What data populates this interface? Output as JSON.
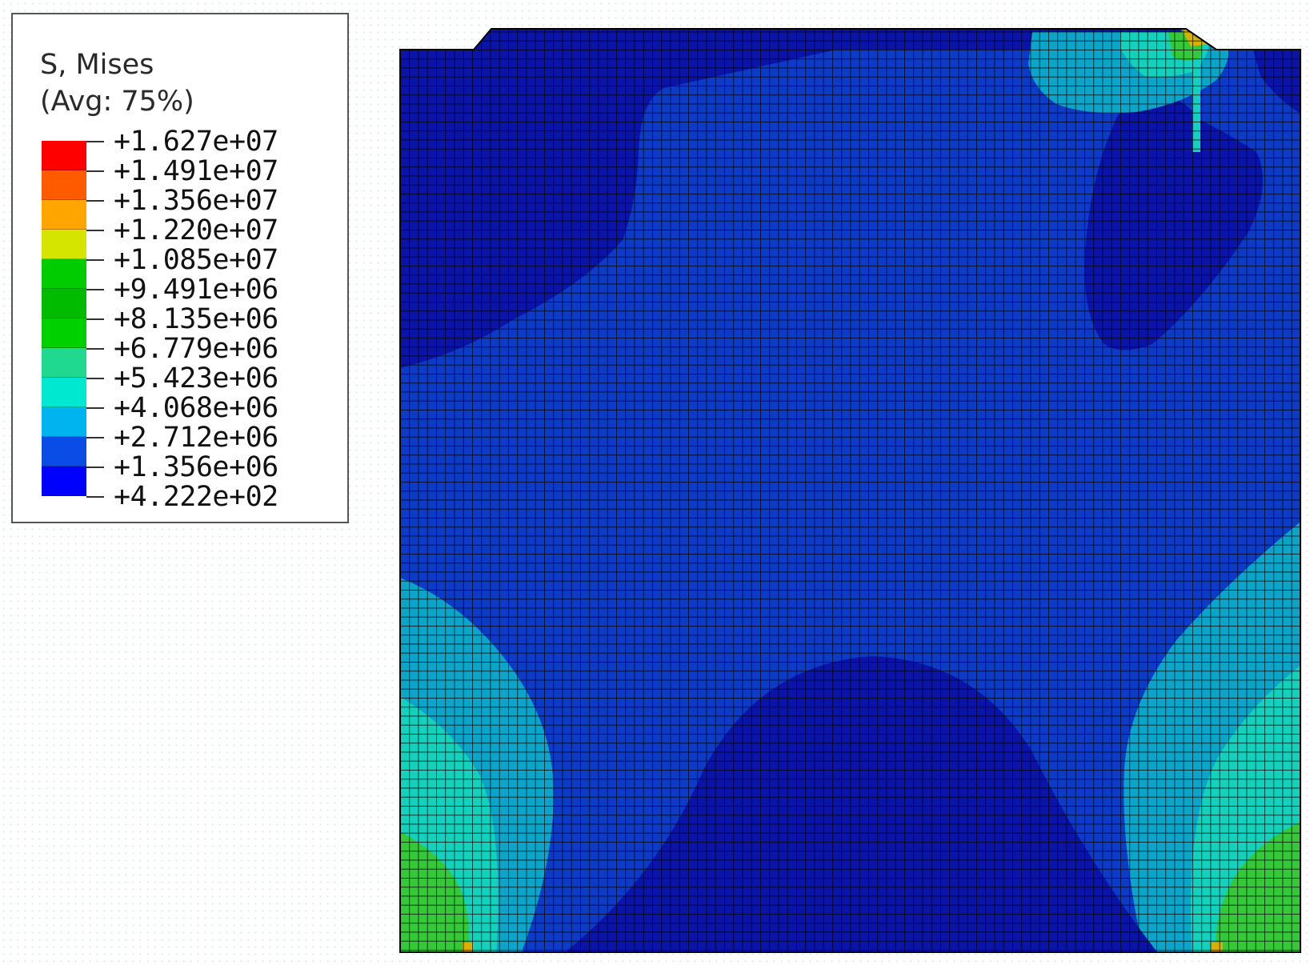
{
  "legend": {
    "title": "S, Mises",
    "subtitle": "(Avg: 75%)",
    "colors": [
      "#ff0000",
      "#ff5a00",
      "#ffa500",
      "#d4e600",
      "#00cc00",
      "#00bb00",
      "#00d000",
      "#20d890",
      "#00e8d0",
      "#00b4f0",
      "#0a4ce6",
      "#0000ff"
    ],
    "values": [
      "+1.627e+07",
      "+1.491e+07",
      "+1.356e+07",
      "+1.220e+07",
      "+1.085e+07",
      "+9.491e+06",
      "+8.135e+06",
      "+6.779e+06",
      "+5.423e+06",
      "+4.068e+06",
      "+2.712e+06",
      "+1.356e+06",
      "+4.222e+02"
    ]
  },
  "contour_colors": {
    "lowest": "#0a14a8",
    "low": "#0c3bc8",
    "mid_low": "#0aa5c8",
    "mid": "#12d2bd",
    "high": "#35c93a",
    "peak": "#d9b000",
    "mesh": "#000000"
  }
}
